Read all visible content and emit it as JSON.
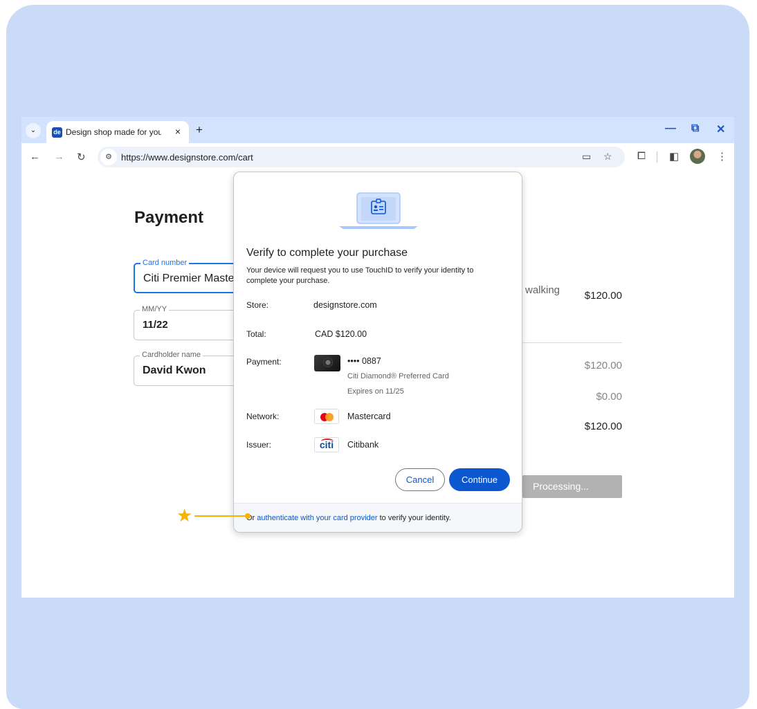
{
  "browser": {
    "tab_title": "Design shop made for you",
    "tab_favicon_text": "de",
    "tab_close": "×",
    "new_tab": "+",
    "url": "https://www.designstore.com/cart",
    "tab_menu_icon": "chevron-down-icon",
    "window_controls": [
      "minimize-icon",
      "restore-icon",
      "close-icon"
    ]
  },
  "page": {
    "title": "Payment",
    "card_number_label": "Card number",
    "card_number_value": "Citi Premier Master...",
    "expiry_label": "MM/YY",
    "expiry_value": "11/22",
    "cardholder_label": "Cardholder name",
    "cardholder_value": "David Kwon",
    "summary_item_text": "walking",
    "prices": [
      "$120.00",
      "$120.00",
      "$0.00",
      "$120.00"
    ],
    "processing_label": "Processing..."
  },
  "dialog": {
    "title": "Verify to complete your purchase",
    "description": "Your device will request you to use TouchID to verify your identity to complete your purchase.",
    "store_label": "Store:",
    "store_value": "designstore.com",
    "total_label": "Total:",
    "total_value": "CAD $120.00",
    "payment_label": "Payment:",
    "card_last4": "•••• 0887",
    "card_name": "Citi Diamond® Preferred Card",
    "card_expiry": "Expires on 11/25",
    "network_label": "Network:",
    "network_value": "Mastercard",
    "issuer_label": "Issuer:",
    "issuer_value": "Citibank",
    "issuer_logo_text": "citi",
    "cancel_label": "Cancel",
    "continue_label": "Continue",
    "footer_prefix": "Or ",
    "footer_link": "authenticate with your card provider",
    "footer_suffix": " to verify your identity."
  },
  "colors": {
    "background": "#c9dbf6",
    "primary": "#0b57d0",
    "annotation": "#f6b400"
  }
}
